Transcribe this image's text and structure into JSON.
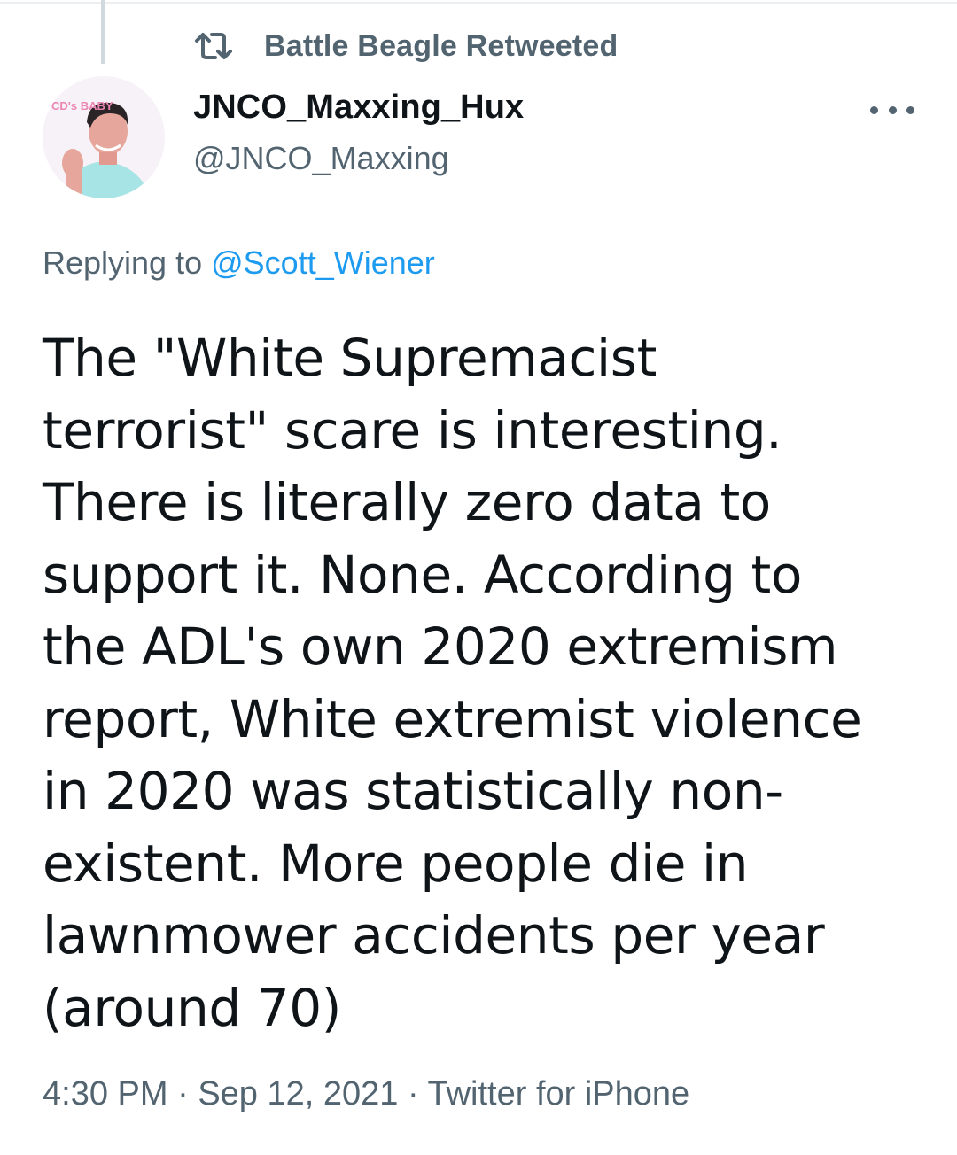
{
  "retweet": {
    "label": "Battle Beagle Retweeted",
    "icon": "retweet-icon"
  },
  "author": {
    "display_name": "JNCO_Maxxing_Hux",
    "handle": "@JNCO_Maxxing",
    "avatar_badge_text": "CD's BABY"
  },
  "menu": {
    "icon": "more-options-icon"
  },
  "reply": {
    "prefix": "Replying to ",
    "mention": "@Scott_Wiener"
  },
  "tweet": {
    "text": "The \"White Supremacist\nterrorist\" scare is interesting.\nThere is literally zero data to\nsupport it. None. According to\nthe ADL's own 2020 extremism\nreport, White extremist violence\nin 2020 was statistically non-\nexistent. More people die in\nlawnmower accidents per year\n(around 70)"
  },
  "meta": {
    "time": "4:30 PM",
    "separator1": " · ",
    "date": "Sep 12, 2021",
    "separator2": " · ",
    "source": "Twitter for iPhone"
  },
  "colors": {
    "secondary_text": "#536471",
    "primary_text": "#0f1419",
    "link": "#1d9bf0"
  }
}
